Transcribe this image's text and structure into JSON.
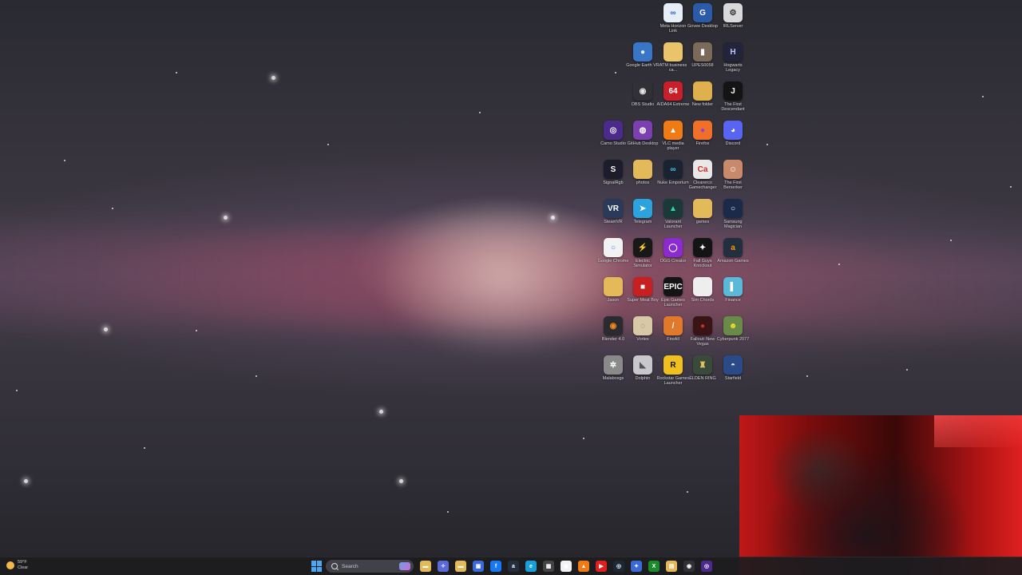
{
  "desktop": {
    "icons": [
      {
        "label": "Meta Horizon Link",
        "glyph": "∞",
        "color": "#e8eef8",
        "fg": "#1e5bd8",
        "icon": "meta-icon"
      },
      {
        "label": "Govee Desktop",
        "glyph": "G",
        "color": "#2b5aa8",
        "fg": "#ffffff",
        "icon": "govee-icon"
      },
      {
        "label": "IRLServer",
        "glyph": "⚙",
        "color": "#d9d9d9",
        "fg": "#333333",
        "icon": "server-icon"
      },
      {
        "label": "Google Earth VR",
        "glyph": "●",
        "color": "#3a76c8",
        "fg": "#e6f0ff",
        "icon": "globe-icon"
      },
      {
        "label": "ATM business ca...",
        "glyph": "",
        "color": "#e9c46a",
        "fg": "#ffffff",
        "icon": "folder-icon"
      },
      {
        "label": "UPES0058",
        "glyph": "▮",
        "color": "#7a6a5a",
        "fg": "#ffffff",
        "icon": "image-icon"
      },
      {
        "label": "Hogwarts Legacy",
        "glyph": "H",
        "color": "#23233a",
        "fg": "#b8c8ff",
        "icon": "hogwarts-icon"
      },
      {
        "label": "OBS Studio",
        "glyph": "◉",
        "color": "#303036",
        "fg": "#e8e8e8",
        "icon": "obs-icon"
      },
      {
        "label": "AIDA64 Extreme",
        "glyph": "64",
        "color": "#c8202a",
        "fg": "#ffffff",
        "icon": "aida-icon"
      },
      {
        "label": "New folder",
        "glyph": "",
        "color": "#e0b04e",
        "fg": "#ffffff",
        "icon": "folder-icon"
      },
      {
        "label": "The First Descendant",
        "glyph": "J",
        "color": "#141414",
        "fg": "#ffffff",
        "icon": "game-icon"
      },
      {
        "label": "Camo Studio",
        "glyph": "◎",
        "color": "#4a2a8a",
        "fg": "#ffffff",
        "icon": "camera-icon"
      },
      {
        "label": "GitHub Desktop",
        "glyph": "◍",
        "color": "#7b3fb0",
        "fg": "#ffffff",
        "icon": "github-icon"
      },
      {
        "label": "VLC media player",
        "glyph": "▲",
        "color": "#f07a14",
        "fg": "#ffffff",
        "icon": "vlc-icon"
      },
      {
        "label": "Firefox",
        "glyph": "●",
        "color": "#f0702a",
        "fg": "#9a3ad8",
        "icon": "firefox-icon"
      },
      {
        "label": "Discord",
        "glyph": "◕",
        "color": "#5865f2",
        "fg": "#ffffff",
        "icon": "discord-icon"
      },
      {
        "label": "SignalRgb",
        "glyph": "S",
        "color": "#1c1c2a",
        "fg": "#ffffff",
        "icon": "signalrgb-icon"
      },
      {
        "label": "photos",
        "glyph": "",
        "color": "#e4b95a",
        "fg": "#ffffff",
        "icon": "folder-icon"
      },
      {
        "label": "Nuke Emporium",
        "glyph": "∞",
        "color": "#1a2430",
        "fg": "#4ac8f0",
        "icon": "app-icon"
      },
      {
        "label": "Clearerco Gamechanger",
        "glyph": "Ca",
        "color": "#e8e8e8",
        "fg": "#d02828",
        "icon": "app-icon"
      },
      {
        "label": "The First Berserker",
        "glyph": "☺",
        "color": "#c88a6a",
        "fg": "#ffffff",
        "icon": "game-icon"
      },
      {
        "label": "SteamVR",
        "glyph": "VR",
        "color": "#2a3a5a",
        "fg": "#ffffff",
        "icon": "steamvr-icon"
      },
      {
        "label": "Telegram",
        "glyph": "➤",
        "color": "#2aa3df",
        "fg": "#ffffff",
        "icon": "telegram-icon"
      },
      {
        "label": "Valorant Launcher",
        "glyph": "▲",
        "color": "#1a3a3a",
        "fg": "#3ad8a8",
        "icon": "game-icon"
      },
      {
        "label": "games",
        "glyph": "",
        "color": "#e4b95a",
        "fg": "#ffffff",
        "icon": "folder-icon"
      },
      {
        "label": "Samsung Magician",
        "glyph": "○",
        "color": "#1c2a4a",
        "fg": "#ffffff",
        "icon": "app-icon"
      },
      {
        "label": "Google Chrome",
        "glyph": "○",
        "color": "#f2f2f2",
        "fg": "#4285f4",
        "icon": "chrome-icon"
      },
      {
        "label": "Electric Simulator",
        "glyph": "⚡",
        "color": "#181818",
        "fg": "#f0d020",
        "icon": "app-icon"
      },
      {
        "label": "OGG Creator",
        "glyph": "◯",
        "color": "#8a2ad0",
        "fg": "#ffffff",
        "icon": "app-icon"
      },
      {
        "label": "Fall Guys Knockout",
        "glyph": "✦",
        "color": "#141414",
        "fg": "#ffffff",
        "icon": "game-icon"
      },
      {
        "label": "Amazon Games",
        "glyph": "a",
        "color": "#232f3e",
        "fg": "#ff9900",
        "icon": "amazon-icon"
      },
      {
        "label": "Jason",
        "glyph": "",
        "color": "#e4b95a",
        "fg": "#ffffff",
        "icon": "folder-icon"
      },
      {
        "label": "Super Meat Boy",
        "glyph": "■",
        "color": "#c82020",
        "fg": "#ffffff",
        "icon": "game-icon"
      },
      {
        "label": "Epic Games Launcher",
        "glyph": "EPIC",
        "color": "#141414",
        "fg": "#ffffff",
        "icon": "epic-icon"
      },
      {
        "label": "Sim Chords",
        "glyph": "",
        "color": "#eeeeee",
        "fg": "#333333",
        "icon": "file-icon"
      },
      {
        "label": "Finance",
        "glyph": "▌",
        "color": "#5ab8d8",
        "fg": "#ffffff",
        "icon": "app-icon"
      },
      {
        "label": "Blender 4.0",
        "glyph": "◉",
        "color": "#2a2a30",
        "fg": "#f08a24",
        "icon": "blender-icon"
      },
      {
        "label": "Vortex",
        "glyph": "◌",
        "color": "#d8c8a8",
        "fg": "#8a6a2a",
        "icon": "app-icon"
      },
      {
        "label": "FireAll",
        "glyph": "/",
        "color": "#e07a2a",
        "fg": "#ffffff",
        "icon": "app-icon"
      },
      {
        "label": "Fallout: New Vegas",
        "glyph": "●",
        "color": "#3a1414",
        "fg": "#c83030",
        "icon": "game-icon"
      },
      {
        "label": "Cyberpunk 2077",
        "glyph": "☻",
        "color": "#6a8a4a",
        "fg": "#f0e020",
        "icon": "game-icon"
      },
      {
        "label": "Malabosgs",
        "glyph": "✲",
        "color": "#8a8a8a",
        "fg": "#ffffff",
        "icon": "app-icon"
      },
      {
        "label": "Dolphin",
        "glyph": "◣",
        "color": "#c8c8cc",
        "fg": "#555555",
        "icon": "app-icon"
      },
      {
        "label": "Rockstar Games Launcher",
        "glyph": "R",
        "color": "#f0c020",
        "fg": "#141414",
        "icon": "rockstar-icon"
      },
      {
        "label": "ELDEN RING",
        "glyph": "♜",
        "color": "#3a4a3a",
        "fg": "#e0c060",
        "icon": "game-icon"
      },
      {
        "label": "Starfield",
        "glyph": "◓",
        "color": "#2a4a8a",
        "fg": "#e8e8e8",
        "icon": "game-icon"
      }
    ]
  },
  "taskbar": {
    "weather_temp": "59°F",
    "weather_desc": "Clear",
    "search_placeholder": "Search",
    "pinned": [
      {
        "name": "file-explorer-icon",
        "color": "#e4b95a",
        "glyph": "▬"
      },
      {
        "name": "copilot-icon",
        "color": "#5a6ad8",
        "glyph": "✧"
      },
      {
        "name": "folder-icon",
        "color": "#e4b95a",
        "glyph": "▬"
      },
      {
        "name": "store-icon",
        "color": "#3a6ad8",
        "glyph": "▣"
      },
      {
        "name": "facebook-icon",
        "color": "#1877f2",
        "glyph": "f"
      },
      {
        "name": "amazon-icon",
        "color": "#232f3e",
        "glyph": "a"
      },
      {
        "name": "edge-icon",
        "color": "#1aa0d8",
        "glyph": "e"
      },
      {
        "name": "calculator-icon",
        "color": "#444448",
        "glyph": "▦"
      },
      {
        "name": "chrome-icon",
        "color": "#f2f2f2",
        "glyph": "◉"
      },
      {
        "name": "vlc-icon",
        "color": "#f07a14",
        "glyph": "▲"
      },
      {
        "name": "youtube-icon",
        "color": "#e02020",
        "glyph": "▶"
      },
      {
        "name": "steam-icon",
        "color": "#1b2838",
        "glyph": "◎"
      },
      {
        "name": "app-icon",
        "color": "#3a6ad8",
        "glyph": "✦"
      },
      {
        "name": "xbox-icon",
        "color": "#1a8a2a",
        "glyph": "X"
      },
      {
        "name": "notepad-icon",
        "color": "#e4b95a",
        "glyph": "▤"
      },
      {
        "name": "obs-icon",
        "color": "#303036",
        "glyph": "◉"
      },
      {
        "name": "camo-icon",
        "color": "#4a2a8a",
        "glyph": "◎"
      }
    ]
  }
}
